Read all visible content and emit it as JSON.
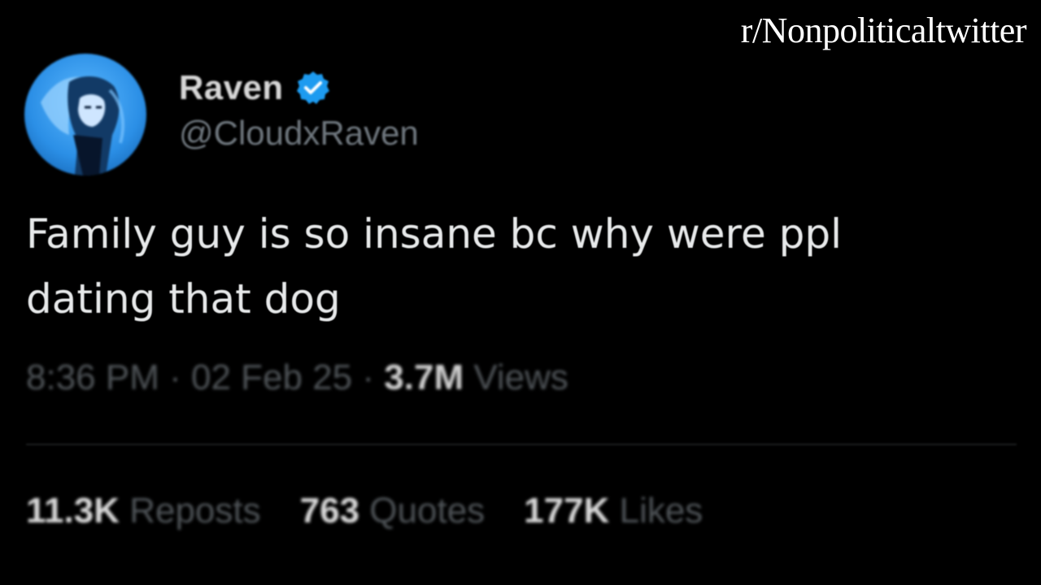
{
  "watermark": "r/Nonpoliticaltwitter",
  "author": {
    "display_name": "Raven",
    "handle": "@CloudxRaven",
    "verified_icon": "verified-badge-icon",
    "avatar_icon": "anime-avatar"
  },
  "tweet": {
    "line1": "Family guy is so insane bc why were ppl",
    "line2": "dating that dog"
  },
  "meta": {
    "time": "8:36 PM",
    "sep1": "·",
    "date": "02 Feb 25",
    "sep2": "·",
    "views_count": "3.7M",
    "views_label": "Views"
  },
  "stats": {
    "reposts_count": "11.3K",
    "reposts_label": "Reposts",
    "quotes_count": "763",
    "quotes_label": "Quotes",
    "likes_count": "177K",
    "likes_label": "Likes"
  },
  "colors": {
    "background": "#000000",
    "verified": "#1d9bf0",
    "avatar_bg": "#2b8fe6"
  }
}
